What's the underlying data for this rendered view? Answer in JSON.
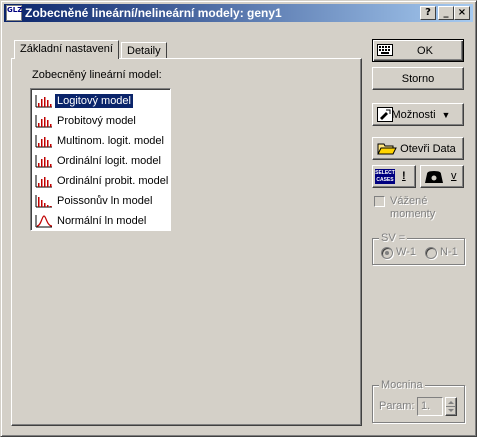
{
  "window": {
    "title": "Zobecněné lineární/nelineární modely: geny1",
    "icon_text": "GLZ",
    "icon": "statistica-glz-icon",
    "caption_buttons": {
      "help": "?",
      "minimize": "_",
      "close": "×"
    }
  },
  "tabs": [
    {
      "label": "Základní nastavení",
      "active": true
    },
    {
      "label": "Detaily",
      "active": false
    }
  ],
  "main": {
    "list_label": "Zobecněný lineární model:",
    "models": [
      {
        "label": "Logitový model",
        "icon": "histogram-icon",
        "selected": true
      },
      {
        "label": "Probitový model",
        "icon": "histogram-icon",
        "selected": false
      },
      {
        "label": "Multinom. logit. model",
        "icon": "histogram-icon",
        "selected": false
      },
      {
        "label": "Ordinální logit. model",
        "icon": "histogram-icon",
        "selected": false
      },
      {
        "label": "Ordinální probit. model",
        "icon": "histogram-icon",
        "selected": false
      },
      {
        "label": "Poissonův ln model",
        "icon": "poisson-histogram-icon",
        "selected": false
      },
      {
        "label": "Normální ln model",
        "icon": "normal-curve-icon",
        "selected": false
      }
    ]
  },
  "side": {
    "ok_label": "OK",
    "cancel_label": "Storno",
    "options_label": "Možnosti",
    "open_data_label": "Otevři Data",
    "select_cases_text": [
      "SELECT",
      "CASES"
    ],
    "select_cases_suffix": "!",
    "weights_suffix": "v",
    "weighted_moments_label": [
      "Vážené",
      "momenty"
    ],
    "sv_group_label": "SV =",
    "sv_options": [
      "W-1",
      "N-1"
    ],
    "sv_selected": "W-1",
    "power_group_label": "Mocnina",
    "param_label": "Param:",
    "param_value": "1."
  },
  "colors": {
    "face": "#d4d0c8",
    "titlebar_start": "#0a246a",
    "titlebar_end": "#a6caf0",
    "selection": "#0a246a",
    "icon_red": "#c00000"
  }
}
